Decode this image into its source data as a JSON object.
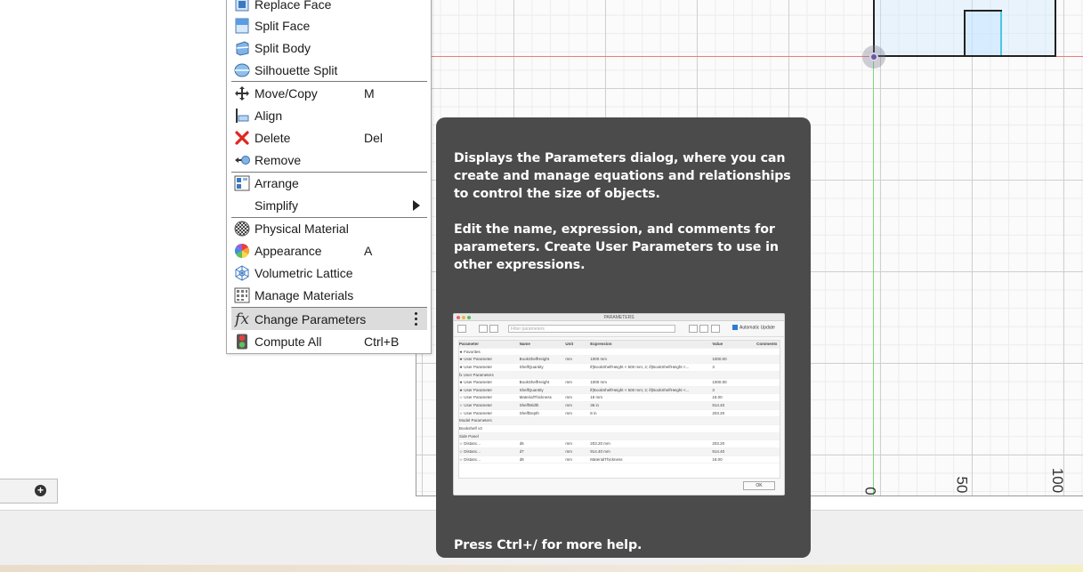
{
  "menu": {
    "items": [
      {
        "id": "replace-face",
        "label": "Replace Face",
        "shortcut": "",
        "icon": "replace-face-icon"
      },
      {
        "id": "split-face",
        "label": "Split Face",
        "shortcut": "",
        "icon": "split-face-icon"
      },
      {
        "id": "split-body",
        "label": "Split Body",
        "shortcut": "",
        "icon": "split-body-icon"
      },
      {
        "id": "silhouette-split",
        "label": "Silhouette Split",
        "shortcut": "",
        "icon": "silhouette-split-icon"
      },
      {
        "id": "move-copy",
        "label": "Move/Copy",
        "shortcut": "M",
        "icon": "move-icon"
      },
      {
        "id": "align",
        "label": "Align",
        "shortcut": "",
        "icon": "align-icon"
      },
      {
        "id": "delete",
        "label": "Delete",
        "shortcut": "Del",
        "icon": "delete-icon"
      },
      {
        "id": "remove",
        "label": "Remove",
        "shortcut": "",
        "icon": "remove-icon"
      },
      {
        "id": "arrange",
        "label": "Arrange",
        "shortcut": "",
        "icon": "arrange-icon"
      },
      {
        "id": "simplify",
        "label": "Simplify",
        "shortcut": "",
        "icon": "submenu-arrow-icon"
      },
      {
        "id": "physical-material",
        "label": "Physical Material",
        "shortcut": "",
        "icon": "physical-material-icon"
      },
      {
        "id": "appearance",
        "label": "Appearance",
        "shortcut": "A",
        "icon": "appearance-icon"
      },
      {
        "id": "volumetric-lattice",
        "label": "Volumetric Lattice",
        "shortcut": "",
        "icon": "lattice-icon"
      },
      {
        "id": "manage-materials",
        "label": "Manage Materials",
        "shortcut": "",
        "icon": "manage-materials-icon"
      },
      {
        "id": "change-parameters",
        "label": "Change Parameters",
        "shortcut": "",
        "icon": "fx-icon"
      },
      {
        "id": "compute-all",
        "label": "Compute All",
        "shortcut": "Ctrl+B",
        "icon": "compute-all-icon"
      }
    ]
  },
  "tooltip": {
    "paragraph1": "Displays the Parameters dialog, where you can create and manage equations and relationships to control the size of objects.",
    "paragraph2": "Edit the name, expression, and comments for parameters. Create User Parameters to use in other expressions.",
    "help": "Press Ctrl+/ for more help."
  },
  "preview": {
    "title": "PARAMETERS",
    "search_placeholder": "Filter parameters",
    "auto_update": "Automatic Update",
    "ok_label": "OK",
    "columns": [
      "Parameter",
      "Name",
      "Unit",
      "Expression",
      "Value",
      "Comments"
    ],
    "rows": [
      [
        "★ Favorites",
        "",
        "",
        "",
        "",
        ""
      ],
      [
        "★ User Parameter",
        "BookShelfHeight",
        "mm",
        "1000 mm",
        "1000.00",
        ""
      ],
      [
        "★ User Parameter",
        "ShelfQuantity",
        "",
        "if(BookShelfHeight < 500 mm; 2; if(BookShelfHeight <...",
        "3",
        ""
      ],
      [
        "fx User Parameters",
        "",
        "",
        "",
        "",
        ""
      ],
      [
        "★ User Parameter",
        "BookShelfHeight",
        "mm",
        "1000 mm",
        "1000.00",
        ""
      ],
      [
        "★ User Parameter",
        "ShelfQuantity",
        "",
        "if(BookShelfHeight < 500 mm; 2; if(BookShelfHeight <...",
        "3",
        ""
      ],
      [
        "☆ User Parameter",
        "MaterialThickness",
        "mm",
        "18 mm",
        "18.00",
        ""
      ],
      [
        "☆ User Parameter",
        "ShelfWidth",
        "mm",
        "36 in",
        "914.40",
        ""
      ],
      [
        "☆ User Parameter",
        "ShelfDepth",
        "mm",
        "8 in",
        "203.20",
        ""
      ],
      [
        "Model Parameters",
        "",
        "",
        "",
        "",
        ""
      ],
      [
        "Bookshelf v3",
        "",
        "",
        "",
        "",
        ""
      ],
      [
        "Side Panel",
        "",
        "",
        "",
        "",
        ""
      ],
      [
        "☆ Distanc...",
        "d6",
        "mm",
        "203.20 mm",
        "203.20",
        ""
      ],
      [
        "☆ Distanc...",
        "d7",
        "mm",
        "914.40 mm",
        "914.40",
        ""
      ],
      [
        "☆ Distanc...",
        "d8",
        "mm",
        "MaterialThickness",
        "18.00",
        ""
      ]
    ]
  },
  "ruler": {
    "labels": [
      "0",
      "50",
      "100"
    ]
  }
}
